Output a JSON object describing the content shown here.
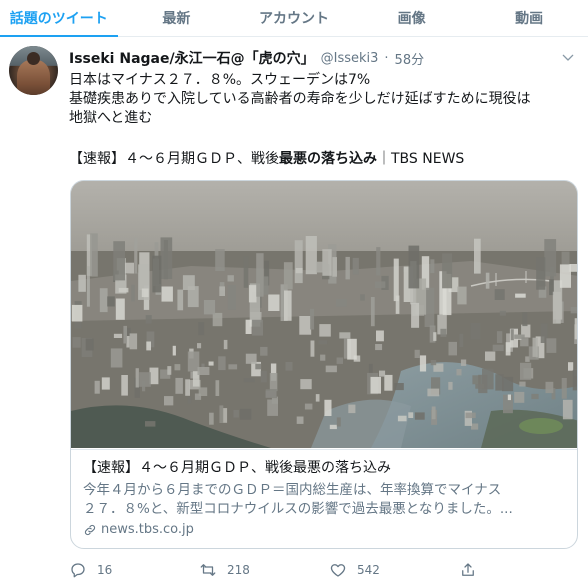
{
  "tabs": [
    {
      "label": "話題のツイート",
      "active": true
    },
    {
      "label": "最新",
      "active": false
    },
    {
      "label": "アカウント",
      "active": false
    },
    {
      "label": "画像",
      "active": false
    },
    {
      "label": "動画",
      "active": false
    }
  ],
  "tweet": {
    "author_name": "Isseki Nagae/永江一石@「虎の穴」",
    "handle": "@Isseki3",
    "separator": "·",
    "time": "58分",
    "lines": [
      "日本はマイナス２７．８%。スウェーデンは7%",
      "基礎疾患ありで入院している高齢者の寿命を少しだけ延ばすために現役は",
      "地獄へと進む"
    ],
    "link_prefix": "【速報】４～６月期ＧＤＰ、戦後",
    "link_bold": "最悪の落ち込み",
    "link_suffix": "｜TBS NEWS",
    "card": {
      "title": "【速報】４～６月期ＧＤＰ、戦後最悪の落ち込み",
      "desc_lines": [
        "今年４月から６月までのＧＤＰ＝国内総生産は、年率換算でマイナス",
        "２７．８%と、新型コロナウイルスの影響で過去最悪となりました。..."
      ],
      "domain": "news.tbs.co.jp"
    },
    "actions": {
      "reply_count": "16",
      "retweet_count": "218",
      "like_count": "542"
    }
  },
  "colors": {
    "accent": "#1da1f2",
    "secondary_text": "#657786",
    "border": "#ccd6dd"
  }
}
